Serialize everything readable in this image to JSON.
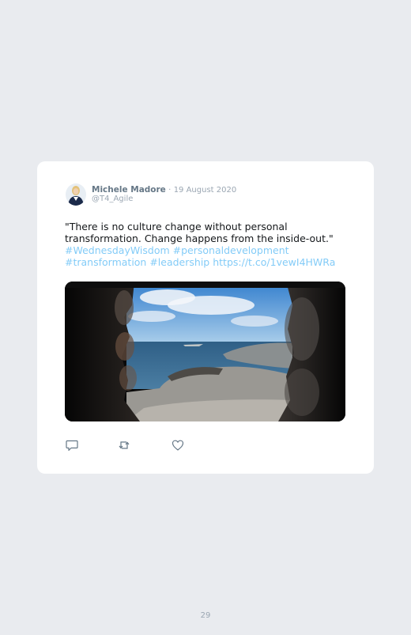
{
  "tweet": {
    "author_name": "Michele Madore",
    "separator": "·",
    "date": "19 August 2020",
    "handle": "@T4_Agile",
    "text_plain": "\"There is no culture change without personal transformation. Change happens from the inside-out.\"",
    "hashtags_line1": "#WednesdayWisdom #personaldevelopment",
    "hashtags_line2": "#transformation #leadership",
    "link": "https://t.co/1vewI4HWRa",
    "image_subject": "coastal view through stone window opening"
  },
  "actions": {
    "reply_icon": "reply-icon",
    "retweet_icon": "retweet-icon",
    "like_icon": "heart-icon"
  },
  "footer": {
    "page_number": "29"
  },
  "colors": {
    "background": "#e9ebef",
    "card": "#ffffff",
    "link": "#1da1f2",
    "muted": "#9aa6b2",
    "name": "#657786"
  }
}
